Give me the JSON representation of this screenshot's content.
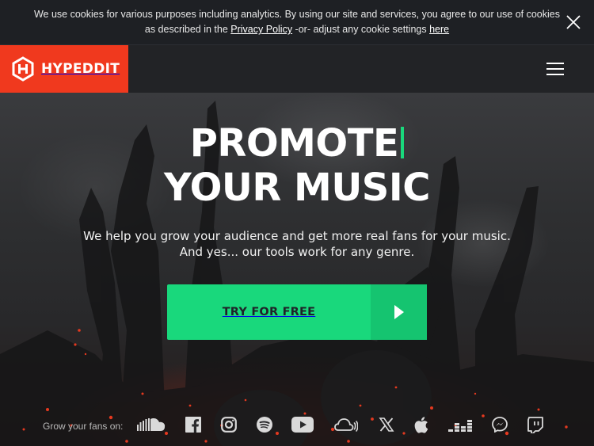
{
  "cookie_bar": {
    "text_1": "We use cookies for various purposes including analytics. By using our site and services, you agree to our use of cookies as described in the ",
    "privacy_link": "Privacy Policy",
    "text_2": " -or- adjust any cookie settings ",
    "here_link": "here"
  },
  "header": {
    "brand": "HYPEDDIT",
    "brand_color": "#f0391e"
  },
  "hero": {
    "headline_1": "PROMOTE",
    "headline_2": "YOUR MUSIC",
    "subtext_1": "We help you grow your audience and get more real fans for your music.",
    "subtext_2": "And yes... our tools work for any genre.",
    "cta_label": "TRY FOR FREE",
    "accent_color": "#19d87c"
  },
  "fans": {
    "label": "Grow your fans on:",
    "platforms": [
      "soundcloud-icon",
      "facebook-icon",
      "instagram-icon",
      "spotify-icon",
      "youtube-icon",
      "mixcloud-icon",
      "x-icon",
      "apple-icon",
      "deezer-icon",
      "messenger-icon",
      "twitch-icon"
    ]
  }
}
